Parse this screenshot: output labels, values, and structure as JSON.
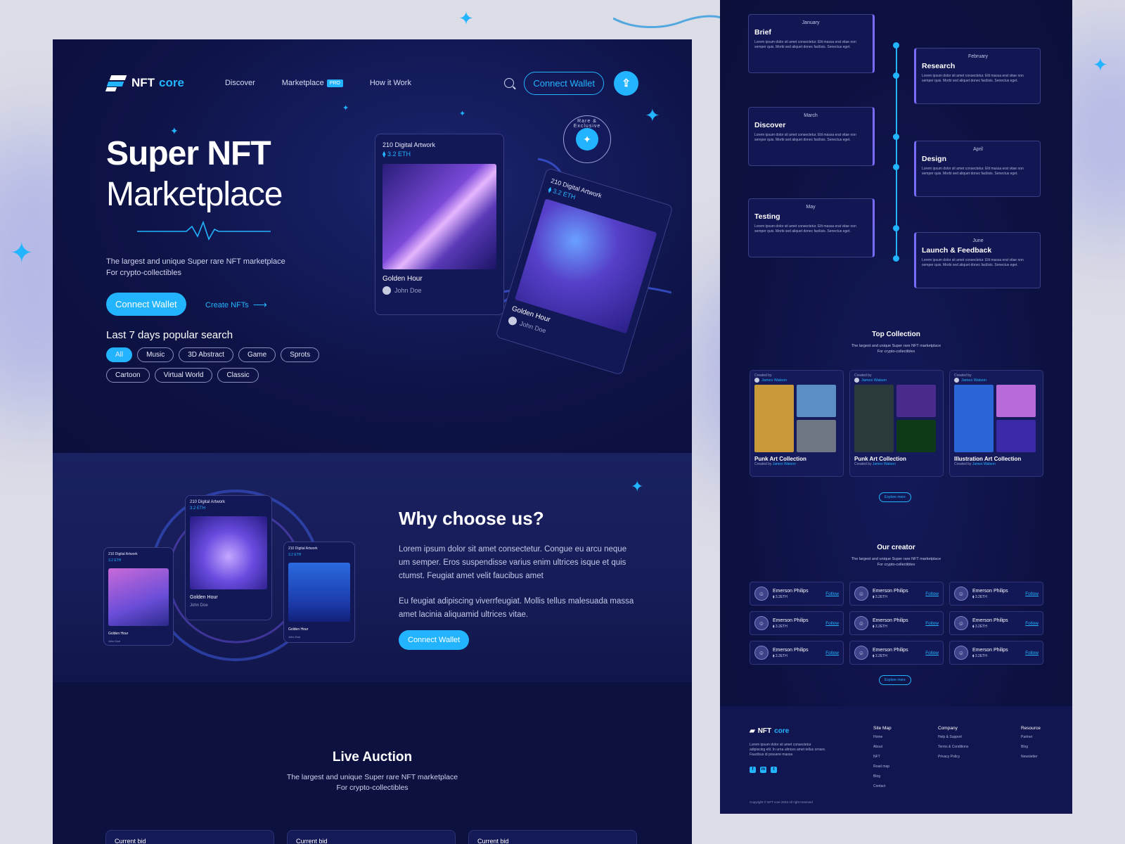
{
  "brand": {
    "name": "NFT",
    "accent_word": "core",
    "accent_color": "#23b4ff",
    "bg_color": "#0d1140"
  },
  "nav": {
    "links": [
      "Discover",
      "Marketplace",
      "How it Work"
    ],
    "pro_badge": "PRO",
    "connect_label": "Connect Wallet",
    "icons": {
      "search": "search-icon",
      "upload": "upload-icon"
    }
  },
  "hero": {
    "title_line1": "Super NFT",
    "title_line2": "Marketplace",
    "desc_line1": "The largest and unique Super rare NFT marketplace",
    "desc_line2": "For crypto-collectibles",
    "connect_label": "Connect Wallet",
    "create_label": "Create NFTs",
    "popular_title": "Last 7 days popular search",
    "chips": [
      "All",
      "Music",
      "3D Abstract",
      "Game",
      "Sprots",
      "Cartoon",
      "Virtual World",
      "Classic"
    ],
    "active_chip": "All",
    "badge_text": "Rare & Exclusive",
    "cards": [
      {
        "title": "210 Digital Artwork",
        "eth": "3.2 ETH",
        "name": "Golden Hour",
        "author": "John Doe"
      },
      {
        "title": "210 Digital Artwork",
        "eth": "3.2 ETH",
        "name": "Golden Hour",
        "author": "John Doe"
      }
    ]
  },
  "why": {
    "title": "Why choose us?",
    "p1": "Lorem ipsum dolor sit amet consectetur. Congue eu arcu neque um semper. Eros suspendisse varius enim ultrices isque et quis ctumst. Feugiat amet velit faucibus amet",
    "p2": "Eu feugiat adipiscing viverrfeugiat. Mollis tellus malesuada massa amet lacinia aliquamid ultrices vitae.",
    "button": "Connect Wallet",
    "cards": [
      {
        "title": "210 Digital Artwork",
        "eth": "3.2 ETH",
        "name": "Golden Hour",
        "author": "John Doe"
      },
      {
        "title": "210 Digital Artwork",
        "eth": "3.2 ETH",
        "name": "Golden Hour",
        "author": "John Doe"
      },
      {
        "title": "210 Digital Artwork",
        "eth": "3.2 ETH",
        "name": "Golden Hour",
        "author": "John Doe"
      }
    ]
  },
  "live": {
    "title": "Live Auction",
    "desc_line1": "The largest and unique Super rare NFT marketplace",
    "desc_line2": "For crypto-collectibles",
    "bid_label": "Current bid"
  },
  "timeline": [
    {
      "month": "January",
      "title": "Brief"
    },
    {
      "month": "February",
      "title": "Research"
    },
    {
      "month": "March",
      "title": "Discover"
    },
    {
      "month": "April",
      "title": "Design"
    },
    {
      "month": "May",
      "title": "Testing"
    },
    {
      "month": "June",
      "title": "Launch & Feedback"
    }
  ],
  "timeline_desc": "Lorem ipsum dolor sit amet consectetur. Elit massa erat vitae non semper quis. Morbi sed aliquet donec facilisis. Senectus eget.",
  "top_collection": {
    "title": "Top Collection",
    "desc_line1": "The largest and unique Super rare NFT marketplace",
    "desc_line2": "For crypto-collectibles",
    "created_by": "Created by",
    "creator": "James Watson",
    "items": [
      "Punk Art Collection",
      "Punk Art Collection",
      "Illustration Art Collection"
    ],
    "explore": "Explore more"
  },
  "creators": {
    "title": "Our creator",
    "desc_line1": "The largest and unique Super rare NFT marketplace",
    "desc_line2": "For crypto-collectibles",
    "name": "Emerson Philips",
    "eth": "3.2ETH",
    "follow": "Follow",
    "explore": "Explore more"
  },
  "footer": {
    "desc": "Lorem ipsum dolor sit amet consectetur adipiscing elit. In urna ultrices amet tellus ornare. Faucibus id posuere massa",
    "sitemap_title": "Site Map",
    "sitemap": [
      "Home",
      "About",
      "NFT",
      "Road map",
      "Blog",
      "Contact"
    ],
    "company_title": "Company",
    "company": [
      "Help & Support",
      "Terms & Conditions",
      "Privacy Policy"
    ],
    "resource_title": "Resource",
    "resource": [
      "Partner",
      "Blog",
      "Newsletter"
    ],
    "copyright": "Copyright © NFT core 2023 All right reserved"
  }
}
